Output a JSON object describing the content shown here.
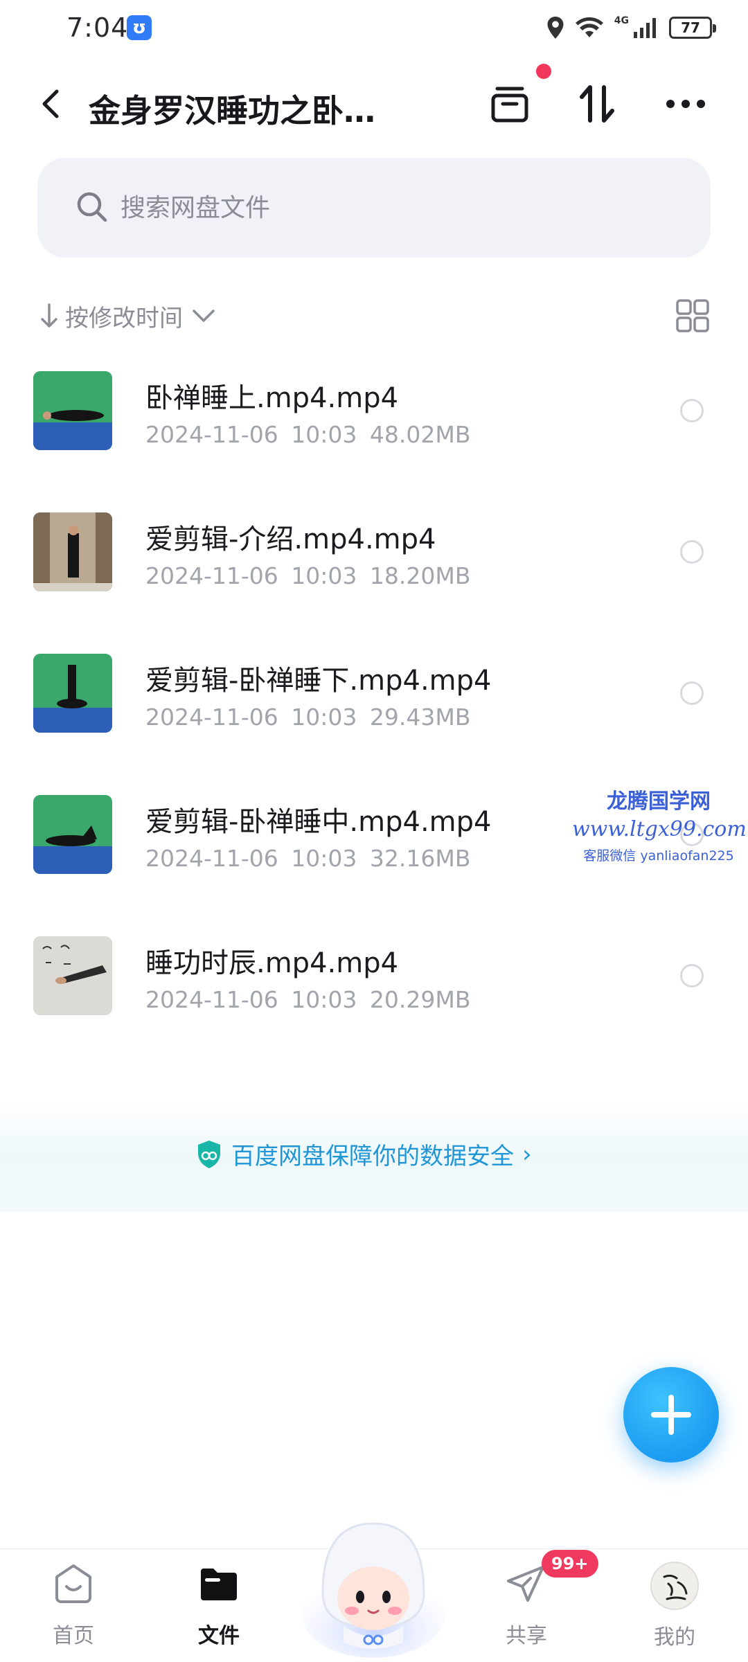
{
  "status_bar": {
    "time": "7:04",
    "network": "4G",
    "battery": "77",
    "battery_level": 0.77
  },
  "header": {
    "title": "金身罗汉睡功之卧…",
    "icons": [
      "back-icon",
      "transfer-box-icon",
      "sort-updown-icon",
      "more-icon"
    ]
  },
  "search": {
    "placeholder": "搜索网盘文件"
  },
  "sort": {
    "label": "按修改时间"
  },
  "files": [
    {
      "name": "卧禅睡上.mp4.mp4",
      "date": "2024-11-06",
      "time": "10:03",
      "size": "48.02MB"
    },
    {
      "name": "爱剪辑-介绍.mp4.mp4",
      "date": "2024-11-06",
      "time": "10:03",
      "size": "18.20MB"
    },
    {
      "name": "爱剪辑-卧禅睡下.mp4.mp4",
      "date": "2024-11-06",
      "time": "10:03",
      "size": "29.43MB"
    },
    {
      "name": "爱剪辑-卧禅睡中.mp4.mp4",
      "date": "2024-11-06",
      "time": "10:03",
      "size": "32.16MB"
    },
    {
      "name": "睡功时辰.mp4.mp4",
      "date": "2024-11-06",
      "time": "10:03",
      "size": "20.29MB"
    }
  ],
  "watermark": {
    "title": "龙腾国学网",
    "url": "www.ltgx99.com",
    "contact": "客服微信 yanliaofan225"
  },
  "security_banner": {
    "text": "百度网盘保障你的数据安全",
    "arrow": "›"
  },
  "bottom_nav": {
    "items": [
      {
        "label": "首页",
        "icon": "home-icon"
      },
      {
        "label": "文件",
        "icon": "folder-icon"
      },
      {
        "label": "共享",
        "icon": "share-plane-icon"
      },
      {
        "label": "我的",
        "icon": "profile-avatar"
      }
    ],
    "share_badge": "99+"
  },
  "colors": {
    "accent_blue": "#1c9cf0",
    "badge_red": "#f0395f",
    "security_text": "#2196d6"
  }
}
